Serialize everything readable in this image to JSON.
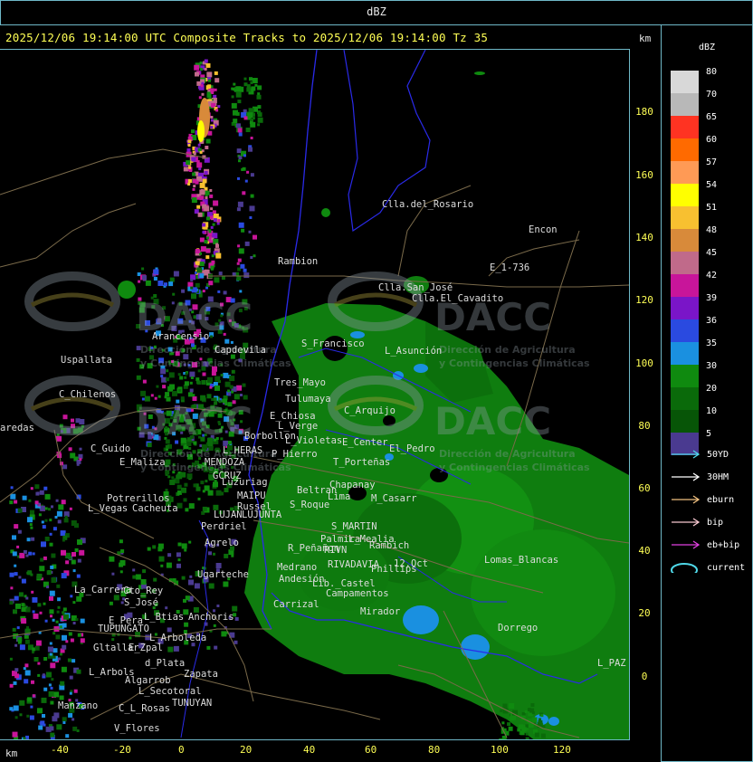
{
  "header": {
    "top_title": "dBZ",
    "title": "2025/12/06 19:14:00 UTC Composite Tracks to 2025/12/06 19:14:00 Tz 35",
    "km_top": "km",
    "km_bottom": "km"
  },
  "axes": {
    "y_ticks": [
      "180",
      "160",
      "140",
      "120",
      "100",
      "80",
      "60",
      "40",
      "20",
      "0"
    ],
    "x_ticks": [
      "-40",
      "-20",
      "0",
      "20",
      "40",
      "60",
      "80",
      "100",
      "120"
    ]
  },
  "legend": {
    "title": "dBZ",
    "levels": [
      {
        "label": "80",
        "color": "#d8d8d8"
      },
      {
        "label": "70",
        "color": "#b8b8b8"
      },
      {
        "label": "65",
        "color": "#ff3322"
      },
      {
        "label": "60",
        "color": "#ff6a00"
      },
      {
        "label": "57",
        "color": "#ff9a55"
      },
      {
        "label": "54",
        "color": "#ffff00"
      },
      {
        "label": "51",
        "color": "#f8c030"
      },
      {
        "label": "48",
        "color": "#d88a3a"
      },
      {
        "label": "45",
        "color": "#c06a8a"
      },
      {
        "label": "42",
        "color": "#c8159a"
      },
      {
        "label": "39",
        "color": "#7a15c8"
      },
      {
        "label": "36",
        "color": "#2a4ae0"
      },
      {
        "label": "35",
        "color": "#1a90e0"
      },
      {
        "label": "30",
        "color": "#0f8a0f"
      },
      {
        "label": "20",
        "color": "#0a6a0a"
      },
      {
        "label": "10",
        "color": "#075507"
      },
      {
        "label": "5",
        "color": "#4a3a90"
      }
    ],
    "tracks": [
      {
        "label": "50YD",
        "color": "#4fd8e8"
      },
      {
        "label": "30HM",
        "color": "#ffffff"
      },
      {
        "label": "eburn",
        "color": "#f0c080"
      },
      {
        "label": "bip",
        "color": "#f8c8d0"
      },
      {
        "label": "eb+bip",
        "color": "#e040e0"
      },
      {
        "label": "current",
        "color": "#4fd8e8"
      }
    ]
  },
  "watermark": {
    "brand": "DACC",
    "line1": "Dirección de Agricultura",
    "line2": "y Contingencias Climáticas"
  },
  "places": [
    "Clla.del_Rosario",
    "Encon",
    "E_1-736",
    "Rambion",
    "Clla.San_José",
    "Clla.El_Cavadito",
    "Uspallata",
    "C_Chilenos",
    "Arancensio",
    "Capdevila",
    "S_Francisco",
    "L_Asunción",
    "Tres_Mayo",
    "Tulumaya",
    "C_Arquijo",
    "E_Chiosa",
    "L_Verge",
    "Borbollon",
    "L_Violetas",
    "E_Center",
    "El_Pedro",
    "L_HERAS",
    "P_Hierro",
    "C_Guido",
    "E_Maliza",
    "MENDOZA",
    "GCRUZ",
    "Luzuriag",
    "Beltran",
    "Chapanay",
    "T_Porteñas",
    "Potrerillos",
    "L_Vegas",
    "Cacheuta",
    "MAIPU",
    "Russel",
    "S_Roque",
    "Lima",
    "M_Casarr",
    "LUJAN",
    "LUJUNTA",
    "Perdriel",
    "S_MARTIN",
    "Palmira",
    "L_Mealia",
    "Agrelo",
    "R_Peñañon",
    "RIVN",
    "Rambich",
    "Ugarteche",
    "Medrano",
    "RIVADAVIA",
    "Phillips",
    "12.Oct",
    "Lomas_Blancas",
    "Anchoris",
    "Andesión",
    "Lib._Castel",
    "Campamentos",
    "Carrizal",
    "La_Carrera",
    "Cto_Rey",
    "S_José",
    "E_Pera",
    "L_Btias",
    "TUPUNGATO",
    "L_Arboleda",
    "Mirador",
    "Dorrego",
    "Gltallar",
    "E_Zpal",
    "d_Plata",
    "L_Arbols",
    "Zapata",
    "Algarrob",
    "L_Secotoral",
    "TUNUYAN",
    "Manzano",
    "C_L_Rosas",
    "V_Flores",
    "L_PAZ",
    "aredas"
  ]
}
